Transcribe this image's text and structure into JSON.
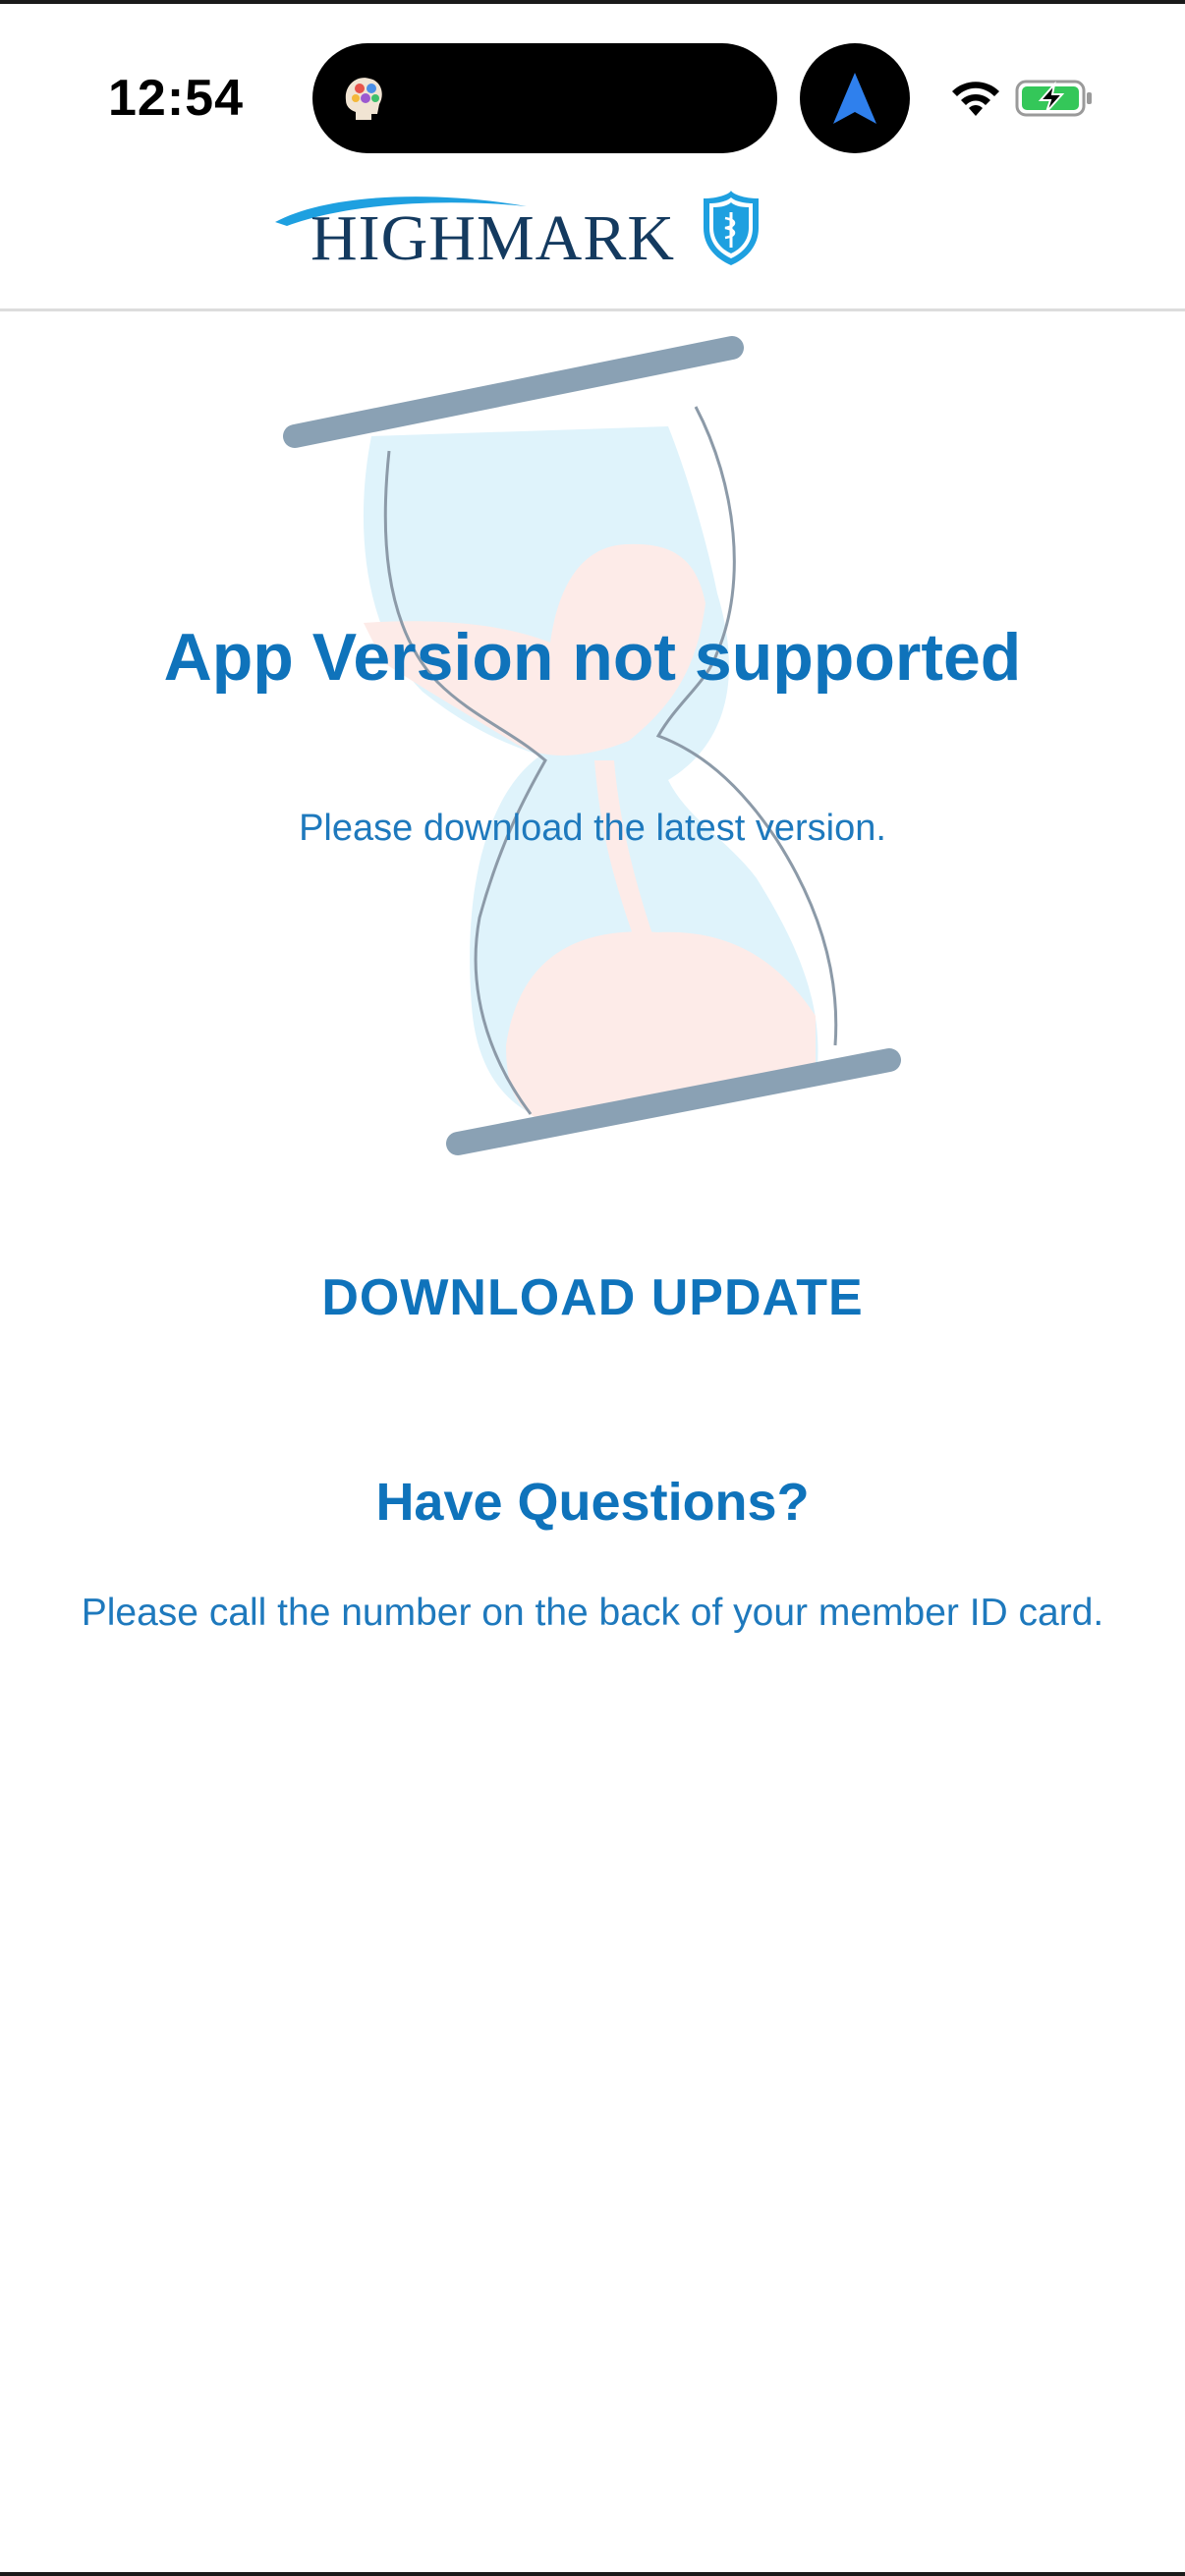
{
  "status_bar": {
    "time": "12:54",
    "island_app_icon": "colorful-brain-icon",
    "nav_icon": "location-arrow-icon",
    "wifi_icon": "wifi-icon",
    "battery_icon": "battery-charging-icon",
    "battery_color": "#34c759"
  },
  "header": {
    "logo_text": "HIGHMARK",
    "logo_icon": "shield-icon"
  },
  "main": {
    "headline": "App Version not supported",
    "subtext": "Please download the latest version.",
    "download_label": "DOWNLOAD UPDATE",
    "questions_heading": "Have Questions?",
    "questions_text": "Please call the number on the back of your member ID card."
  },
  "colors": {
    "accent": "#0f73bb",
    "navy": "#143a5f",
    "hourglass_frame": "#8aa1b4",
    "hourglass_glass": "#dff3fb",
    "hourglass_sand": "#fdebe8"
  }
}
